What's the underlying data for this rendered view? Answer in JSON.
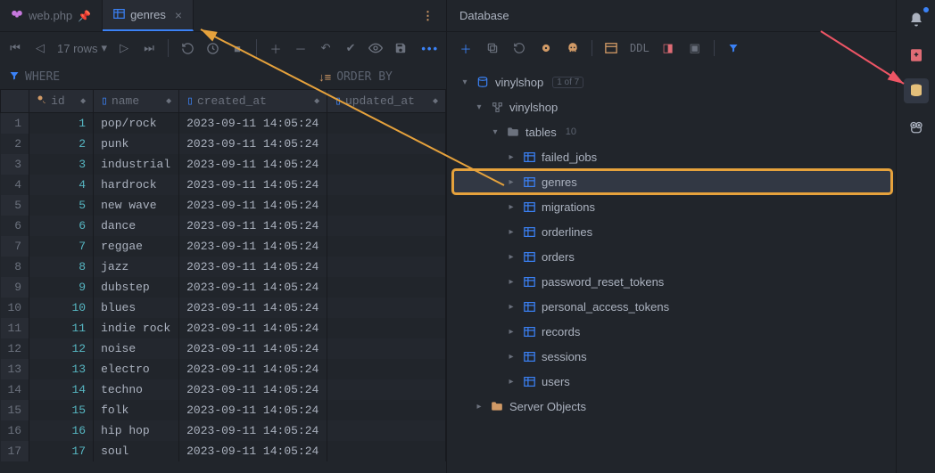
{
  "tabs": [
    {
      "label": "web.php",
      "icon": "elephant-icon",
      "pinned": true,
      "active": false
    },
    {
      "label": "genres",
      "icon": "table-icon",
      "pinned": false,
      "active": true
    }
  ],
  "toolbar": {
    "row_count_label": "17 rows"
  },
  "filters": {
    "where_label": "WHERE",
    "orderby_label": "ORDER BY"
  },
  "columns": [
    {
      "name": "id",
      "icon": "key-icon"
    },
    {
      "name": "name",
      "icon": "column-icon"
    },
    {
      "name": "created_at",
      "icon": "column-icon"
    },
    {
      "name": "updated_at",
      "icon": "column-icon"
    }
  ],
  "rows": [
    {
      "n": 1,
      "id": 1,
      "name": "pop/rock",
      "created_at": "2023-09-11 14:05:24",
      "updated_at": "<null>"
    },
    {
      "n": 2,
      "id": 2,
      "name": "punk",
      "created_at": "2023-09-11 14:05:24",
      "updated_at": "<null>"
    },
    {
      "n": 3,
      "id": 3,
      "name": "industrial",
      "created_at": "2023-09-11 14:05:24",
      "updated_at": "<null>"
    },
    {
      "n": 4,
      "id": 4,
      "name": "hardrock",
      "created_at": "2023-09-11 14:05:24",
      "updated_at": "<null>"
    },
    {
      "n": 5,
      "id": 5,
      "name": "new wave",
      "created_at": "2023-09-11 14:05:24",
      "updated_at": "<null>"
    },
    {
      "n": 6,
      "id": 6,
      "name": "dance",
      "created_at": "2023-09-11 14:05:24",
      "updated_at": "<null>"
    },
    {
      "n": 7,
      "id": 7,
      "name": "reggae",
      "created_at": "2023-09-11 14:05:24",
      "updated_at": "<null>"
    },
    {
      "n": 8,
      "id": 8,
      "name": "jazz",
      "created_at": "2023-09-11 14:05:24",
      "updated_at": "<null>"
    },
    {
      "n": 9,
      "id": 9,
      "name": "dubstep",
      "created_at": "2023-09-11 14:05:24",
      "updated_at": "<null>"
    },
    {
      "n": 10,
      "id": 10,
      "name": "blues",
      "created_at": "2023-09-11 14:05:24",
      "updated_at": "<null>"
    },
    {
      "n": 11,
      "id": 11,
      "name": "indie rock",
      "created_at": "2023-09-11 14:05:24",
      "updated_at": "<null>"
    },
    {
      "n": 12,
      "id": 12,
      "name": "noise",
      "created_at": "2023-09-11 14:05:24",
      "updated_at": "<null>"
    },
    {
      "n": 13,
      "id": 13,
      "name": "electro",
      "created_at": "2023-09-11 14:05:24",
      "updated_at": "<null>"
    },
    {
      "n": 14,
      "id": 14,
      "name": "techno",
      "created_at": "2023-09-11 14:05:24",
      "updated_at": "<null>"
    },
    {
      "n": 15,
      "id": 15,
      "name": "folk",
      "created_at": "2023-09-11 14:05:24",
      "updated_at": "<null>"
    },
    {
      "n": 16,
      "id": 16,
      "name": "hip hop",
      "created_at": "2023-09-11 14:05:24",
      "updated_at": "<null>"
    },
    {
      "n": 17,
      "id": 17,
      "name": "soul",
      "created_at": "2023-09-11 14:05:24",
      "updated_at": "<null>"
    }
  ],
  "right_panel": {
    "title": "Database",
    "ddl_label": "DDL",
    "root": {
      "label": "vinylshop",
      "badge": "1 of 7"
    },
    "schema": {
      "label": "vinylshop"
    },
    "tables_group": {
      "label": "tables",
      "count": "10"
    },
    "tables": [
      "failed_jobs",
      "genres",
      "migrations",
      "orderlines",
      "orders",
      "password_reset_tokens",
      "personal_access_tokens",
      "records",
      "sessions",
      "users"
    ],
    "server_objects_label": "Server Objects"
  }
}
